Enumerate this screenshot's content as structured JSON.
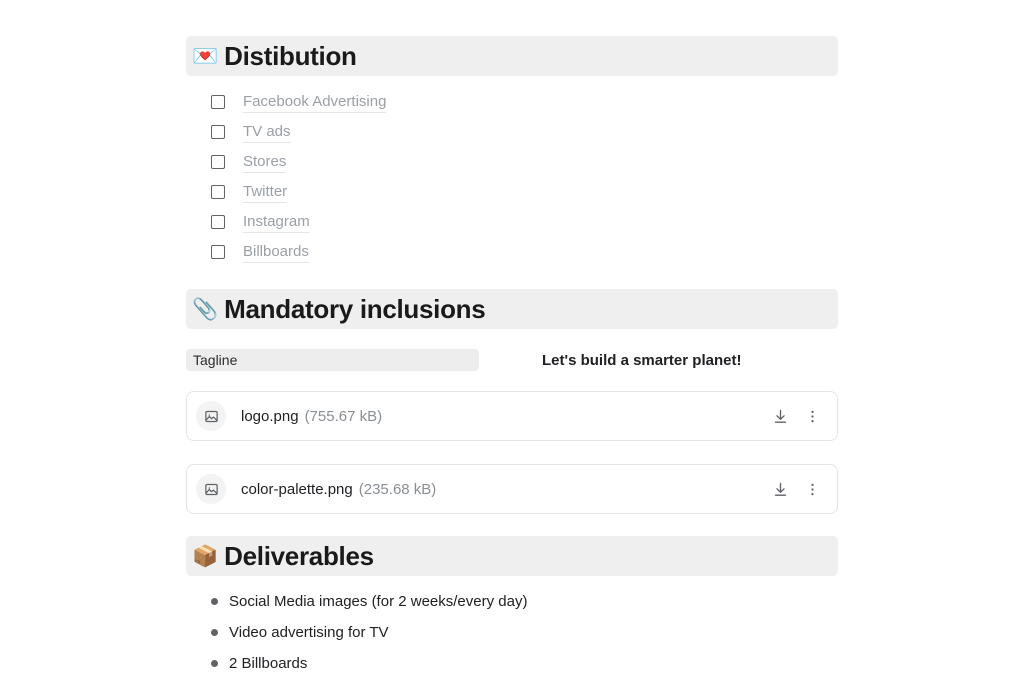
{
  "sections": {
    "distribution": {
      "emoji": "💌",
      "emoji_name": "love-letter-emoji",
      "title": "Distibution",
      "options": [
        {
          "label": "Facebook Advertising",
          "checked": false
        },
        {
          "label": "TV ads",
          "checked": false
        },
        {
          "label": "Stores",
          "checked": false
        },
        {
          "label": "Twitter",
          "checked": false
        },
        {
          "label": "Instagram",
          "checked": false
        },
        {
          "label": "Billboards",
          "checked": false
        }
      ]
    },
    "mandatory_inclusions": {
      "emoji": "📎",
      "emoji_name": "paperclip-emoji",
      "title": "Mandatory inclusions",
      "tagline_field": {
        "label": "Tagline",
        "value": "Let's build a smarter planet!"
      },
      "attachments": [
        {
          "icon": "image-file-icon",
          "name": "logo.png",
          "size": "(755.67 kB)",
          "download_label": "download-icon",
          "menu_label": "more-options-icon"
        },
        {
          "icon": "image-file-icon",
          "name": "color-palette.png",
          "size": "(235.68 kB)",
          "download_label": "download-icon",
          "menu_label": "more-options-icon"
        }
      ]
    },
    "deliverables": {
      "emoji": "📦",
      "emoji_name": "package-emoji",
      "title": "Deliverables",
      "items": [
        "Social Media images (for 2 weeks/every day)",
        "Video advertising for TV",
        "2 Billboards"
      ]
    }
  },
  "colors": {
    "section_header_bg": "#efefef",
    "field_label_bg": "#ededed",
    "muted_text": "#9aa0a6",
    "body_text": "#202124",
    "card_border": "#e4e4e4"
  }
}
